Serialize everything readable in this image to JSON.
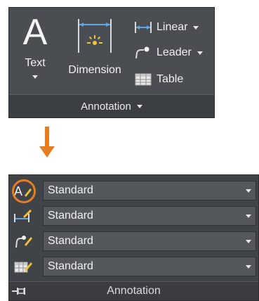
{
  "top_panel": {
    "text_button": {
      "label": "Text",
      "glyph": "A"
    },
    "dimension_button": {
      "label": "Dimension"
    },
    "small_buttons": [
      {
        "label": "Linear",
        "icon": "linear-dimension-icon"
      },
      {
        "label": "Leader",
        "icon": "leader-icon"
      },
      {
        "label": "Table",
        "icon": "table-icon"
      }
    ],
    "footer_label": "Annotation"
  },
  "expanded_panel": {
    "rows": [
      {
        "icon": "text-style-icon",
        "value": "Standard"
      },
      {
        "icon": "dimension-style-icon",
        "value": "Standard"
      },
      {
        "icon": "multileader-style-icon",
        "value": "Standard"
      },
      {
        "icon": "table-style-icon",
        "value": "Standard"
      }
    ],
    "footer_label": "Annotation"
  },
  "colors": {
    "accent_orange": "#e57e22",
    "panel_dark": "#4a4d51",
    "icon_gold": "#f1c232"
  }
}
